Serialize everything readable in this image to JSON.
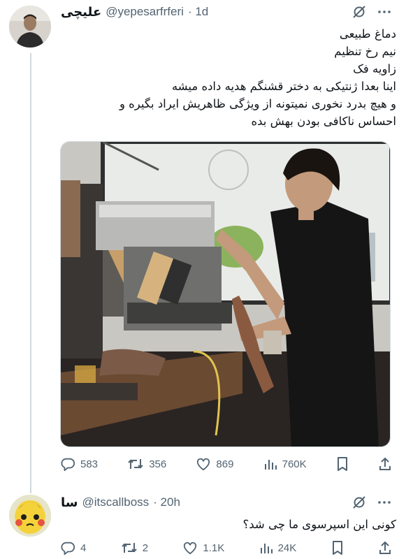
{
  "tweet": {
    "author_name": "علیچی",
    "handle": "@yepesarfrferi",
    "time": "· 1d",
    "lines": [
      "دماغ طبیعی",
      "نیم رخ تنظیم",
      "زاویه فک",
      "اینا بعدا ژنتیکی به دختر قشنگم هدیه داده میشه",
      "و هیچ بدرد نخوری نمیتونه از ویژگی ظاهریش ایراد بگیره و",
      "احساس ناکافی بودن بهش بده"
    ],
    "stats": {
      "replies": "583",
      "retweets": "356",
      "likes": "869",
      "views": "760K"
    }
  },
  "reply": {
    "author_name": "سا",
    "handle": "@itscallboss",
    "time": "· 20h",
    "text": "کونی این اسپرسوی ما چی شد؟",
    "stats": {
      "replies": "4",
      "retweets": "2",
      "likes": "1.1K",
      "views": "24K"
    }
  },
  "colors": {
    "text": "#0f1419",
    "secondary": "#536471",
    "thread_line": "#cfd9de"
  },
  "icons": [
    "grok-icon",
    "more-icon",
    "reply-icon",
    "retweet-icon",
    "like-icon",
    "views-icon",
    "bookmark-icon",
    "share-icon"
  ]
}
